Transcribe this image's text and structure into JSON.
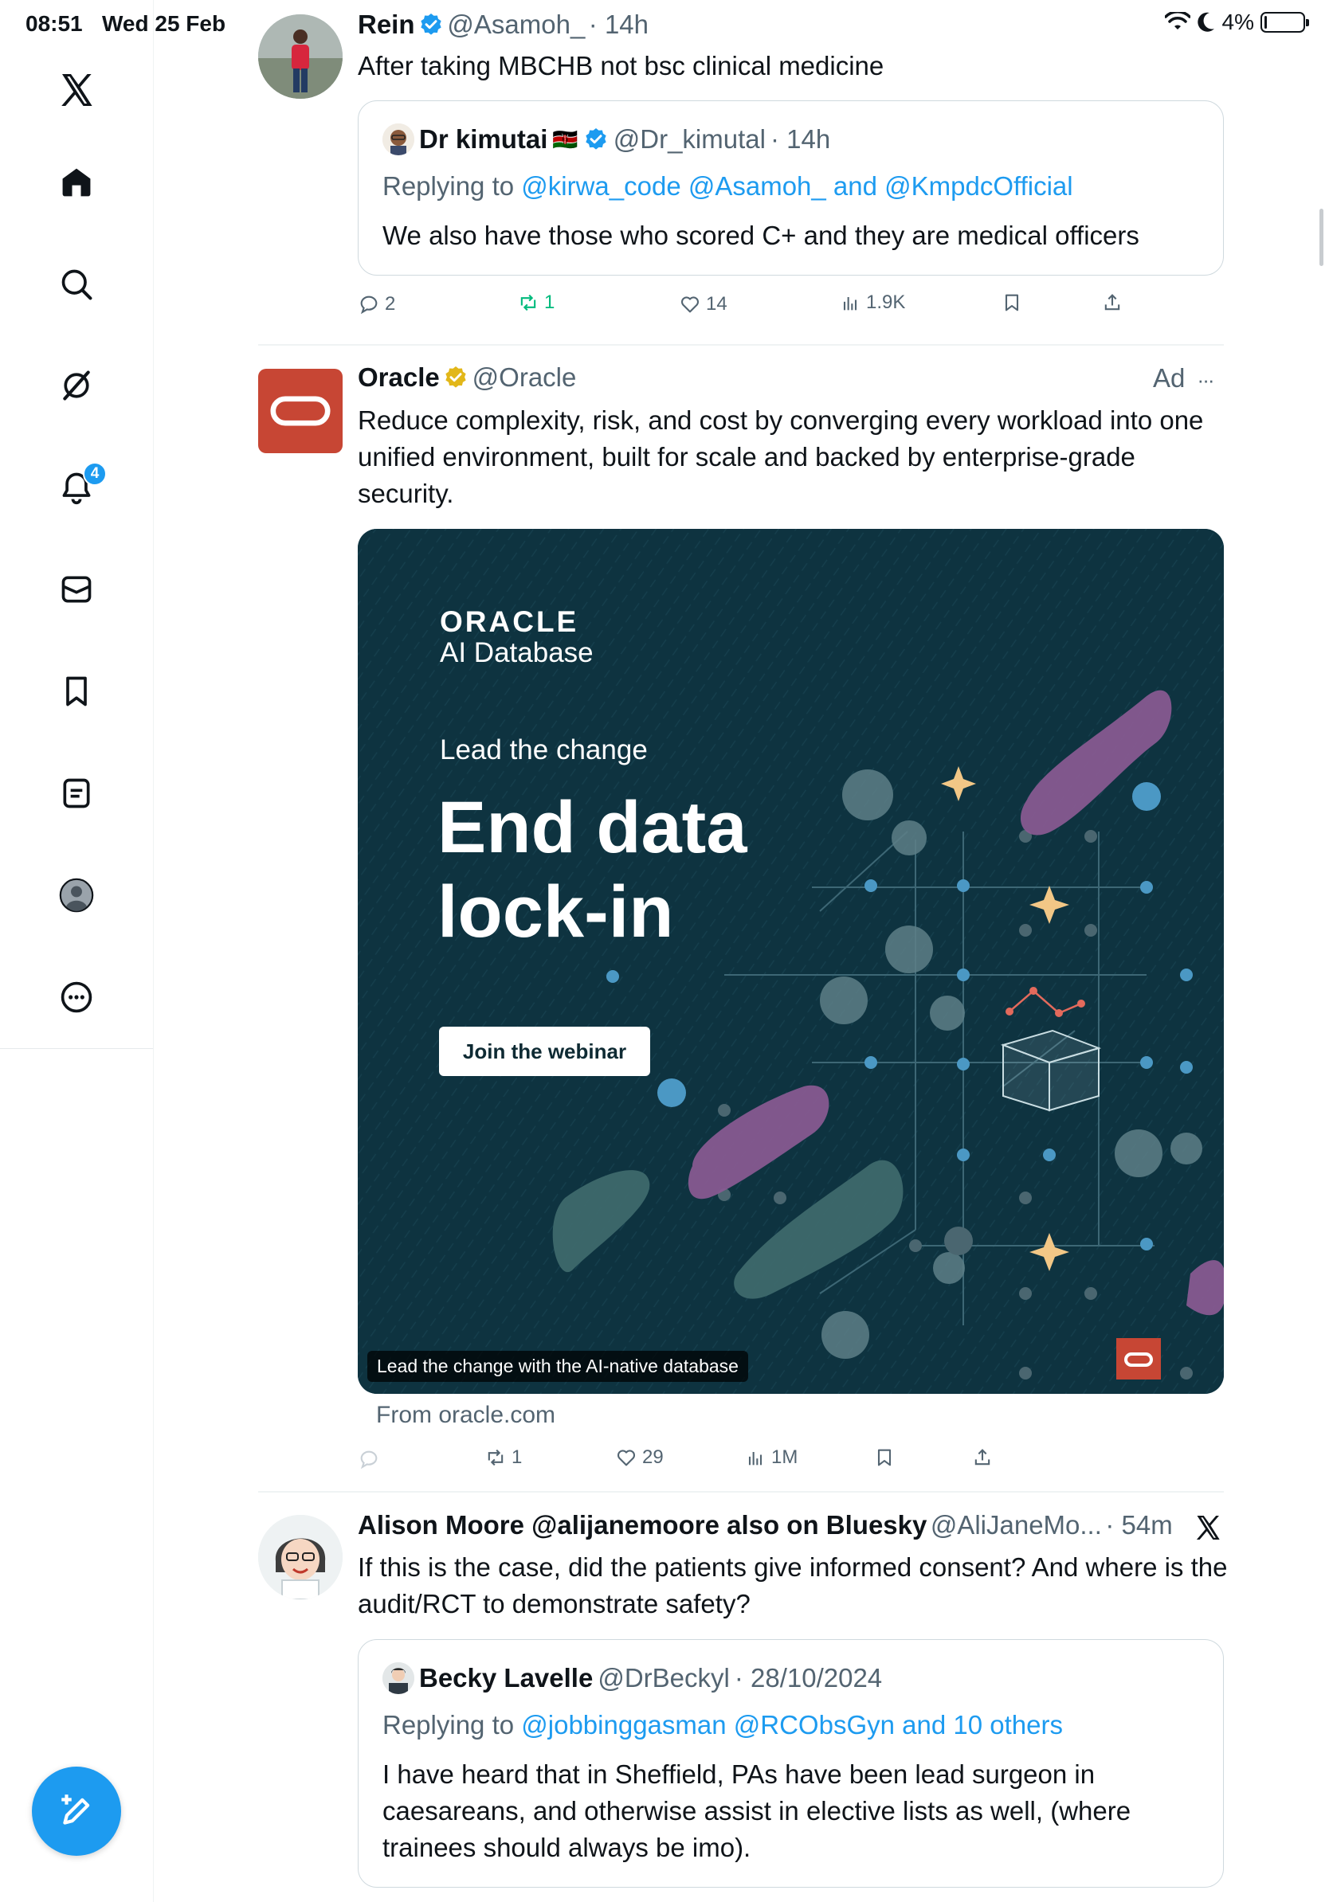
{
  "status_bar": {
    "time": "08:51",
    "date": "Wed 25 Feb",
    "battery": "4%",
    "battery_level": 0.04
  },
  "sidebar": {
    "items": [
      "home",
      "search",
      "grok",
      "notifications",
      "messages",
      "bookmarks",
      "lists",
      "profile",
      "more"
    ],
    "notification_count": "4"
  },
  "tweet1": {
    "name": "Rein",
    "handle": "@Asamoh_",
    "time": "· 14h",
    "text": "After taking MBCHB not bsc clinical medicine",
    "quote": {
      "name": "Dr kimutai",
      "flag": "🇰🇪",
      "handle": "@Dr_kimutal",
      "time": "· 14h",
      "replying_prefix": "Replying to ",
      "replying_links": "@kirwa_code @Asamoh_ and @KmpdcOfficial",
      "text": "We also have those who scored C+ and they are medical officers"
    },
    "actions": {
      "replies": "2",
      "reposts": "1",
      "likes": "14",
      "views": "1.9K"
    }
  },
  "tweet2": {
    "name": "Oracle",
    "handle": "@Oracle",
    "ad_label": "Ad",
    "more": "···",
    "text": "Reduce complexity, risk, and cost by converging every workload into one unified environment, built for scale and backed by enterprise-grade security.",
    "creative": {
      "brand": "ORACLE",
      "product": "AI Database",
      "kicker": "Lead the change",
      "headline_1": "End data",
      "headline_2": "lock-in",
      "cta": "Join the webinar",
      "caption": "Lead the change with the AI-native database"
    },
    "from": "From oracle.com",
    "actions": {
      "reposts": "1",
      "likes": "29",
      "views": "1M"
    }
  },
  "tweet3": {
    "name": "Alison Moore @alijanemoore also on Bluesky",
    "handle": "@AliJaneMo...",
    "time": "· 54m",
    "text": "If this is the case, did the patients give informed consent? And where is the audit/RCT to demonstrate safety?",
    "quote": {
      "name": "Becky Lavelle",
      "handle": "@DrBeckyl",
      "time": "· 28/10/2024",
      "replying_prefix": "Replying to ",
      "replying_links": "@jobbinggasman @RCObsGyn and 10 others",
      "text": "I have heard that in Sheffield, PAs have been lead surgeon in caesareans, and otherwise assist in elective lists as well, (where trainees should always be imo)."
    }
  },
  "colors": {
    "accent": "#1d9bf0",
    "repost_active": "#00ba7c",
    "oracle_red": "#c74634",
    "creative_bg": "#0e3340"
  }
}
